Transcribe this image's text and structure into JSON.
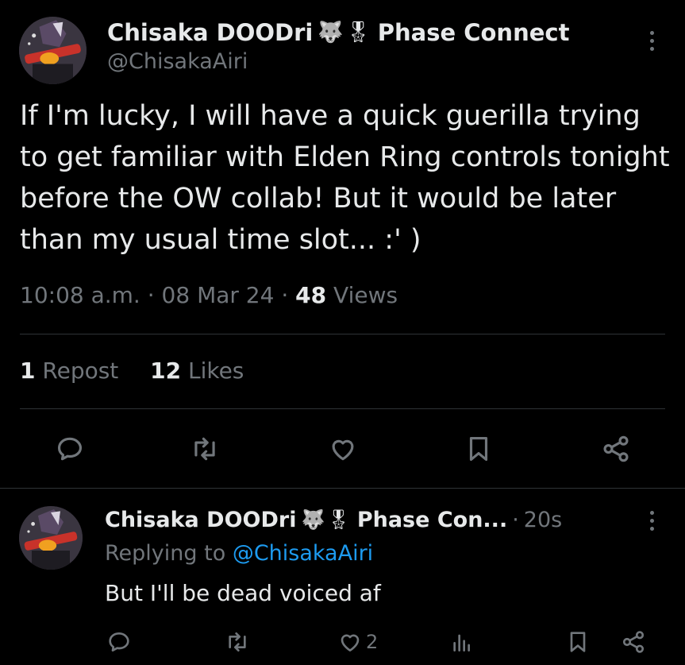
{
  "main_tweet": {
    "display_name": "Chisaka DOODri",
    "name_emojis": [
      "🐺",
      "🎖"
    ],
    "affiliation": "Phase Connect",
    "handle": "@ChisakaAiri",
    "text": "If I'm lucky, I will have a quick guerilla trying to get familiar with Elden Ring controls tonight before the OW collab! But it would be later than my usual time slot... :' )",
    "time": "10:08 a.m.",
    "date": "08 Mar 24",
    "separator": "·",
    "views_count": "48",
    "views_label": "Views",
    "reposts_count": "1",
    "reposts_label": "Repost",
    "likes_count": "12",
    "likes_label": "Likes",
    "actions": [
      "reply-icon",
      "retweet-icon",
      "heart-icon",
      "bookmark-icon",
      "share-icon"
    ]
  },
  "reply_tweet": {
    "display_name": "Chisaka DOODri",
    "name_emojis": [
      "🐺",
      "🎖"
    ],
    "affiliation": "Phase Con...",
    "separator": "·",
    "time": "20s",
    "replying_prefix": "Replying to",
    "replying_handle": "@ChisakaAiri",
    "text": "But I'll be dead voiced af",
    "like_count": "2",
    "actions": [
      "reply-icon",
      "retweet-icon",
      "heart-icon",
      "analytics-icon",
      "bookmark-icon",
      "share-icon"
    ]
  },
  "colors": {
    "background": "#000000",
    "primary_text": "#e7e9ea",
    "secondary_text": "#71767b",
    "link": "#1d9bf0",
    "divider": "#2f3336"
  }
}
